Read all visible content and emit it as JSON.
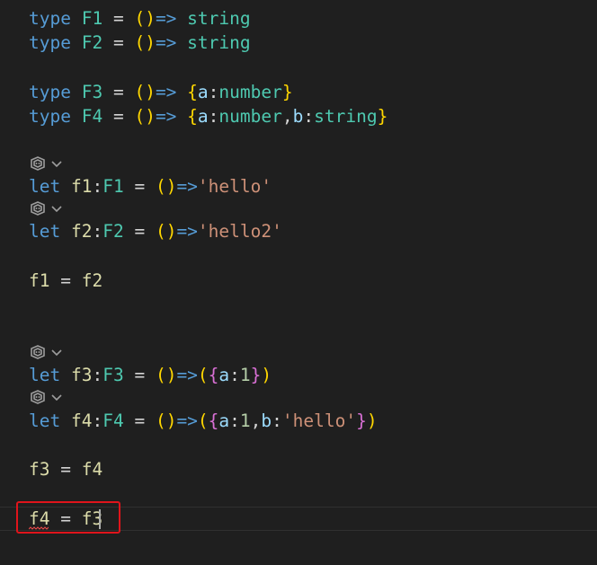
{
  "lines": {
    "l1": {
      "kw": "type",
      "name": "F1",
      "eq": "=",
      "paren": "()",
      "arrow": "=>",
      "ret": "string"
    },
    "l2": {
      "kw": "type",
      "name": "F2",
      "eq": "=",
      "paren": "()",
      "arrow": "=>",
      "ret": "string"
    },
    "l3": {
      "kw": "type",
      "name": "F3",
      "eq": "=",
      "paren": "()",
      "arrow": "=>",
      "open": "{",
      "p1": "a",
      "colon": ":",
      "t1": "number",
      "close": "}"
    },
    "l4": {
      "kw": "type",
      "name": "F4",
      "eq": "=",
      "paren": "()",
      "arrow": "=>",
      "open": "{",
      "p1": "a",
      "colon": ":",
      "t1": "number",
      "comma": ",",
      "p2": "b",
      "colon2": ":",
      "t2": "string",
      "close": "}"
    },
    "l5": {
      "kw": "let",
      "var": "f1",
      "colon": ":",
      "type": "F1",
      "eq": "=",
      "paren": "()",
      "arrow": "=>",
      "value": "'hello'"
    },
    "l6": {
      "kw": "let",
      "var": "f2",
      "colon": ":",
      "type": "F2",
      "eq": "=",
      "paren": "()",
      "arrow": "=>",
      "value": "'hello2'"
    },
    "l7": {
      "lhs": "f1",
      "eq": "=",
      "rhs": "f2"
    },
    "l8": {
      "kw": "let",
      "var": "f3",
      "colon": ":",
      "type": "F3",
      "eq": "=",
      "paren": "()",
      "arrow": "=>",
      "open": "(",
      "brace": "{",
      "p1": "a",
      "colon2": ":",
      "v1": "1",
      "brace_close": "}",
      "close": ")"
    },
    "l9": {
      "kw": "let",
      "var": "f4",
      "colon": ":",
      "type": "F4",
      "eq": "=",
      "paren": "()",
      "arrow": "=>",
      "open": "(",
      "brace": "{",
      "p1": "a",
      "colon2": ":",
      "v1": "1",
      "comma": ",",
      "p2": "b",
      "colon3": ":",
      "v2": "'hello'",
      "brace_close": "}",
      "close": ")"
    },
    "l10": {
      "lhs": "f3",
      "eq": "=",
      "rhs": "f4"
    },
    "l11": {
      "lhs": "f4",
      "eq": "=",
      "rhs": "f3"
    }
  },
  "icons": {
    "code_lens": "copilot-icon",
    "expand": "chevron-down-icon"
  },
  "colors": {
    "background": "#1f1f1f",
    "keyword": "#569cd6",
    "type": "#4ec9b0",
    "function": "#dcdcaa",
    "property": "#9cdcfe",
    "bracket_gold": "#ffd700",
    "bracket_orchid": "#da70d6",
    "string": "#ce9178",
    "number": "#b5cea8",
    "highlight_box": "#e0141b",
    "error_squiggle": "#f14c4c"
  }
}
